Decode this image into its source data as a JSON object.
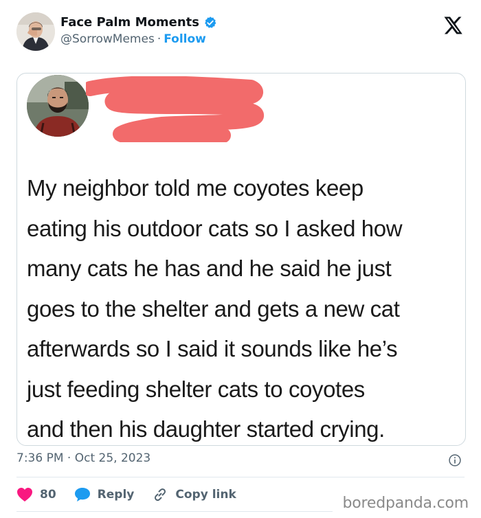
{
  "author": {
    "display_name": "Face Palm Moments",
    "handle": "@SorrowMemes",
    "separator": "·",
    "follow_label": "Follow"
  },
  "quoted_tweet": {
    "lines": [
      "My neighbor told me coyotes keep",
      "eating his outdoor cats so I asked how",
      "many cats he has and he said he just",
      "goes to the shelter and gets a new cat",
      "afterwards so I said it sounds like he’s",
      "just feeding shelter cats to coyotes",
      "and then his daughter started crying."
    ]
  },
  "meta": {
    "time": "7:36 PM",
    "separator": "·",
    "date": "Oct 25, 2023"
  },
  "actions": {
    "like_count": "80",
    "reply_label": "Reply",
    "copy_label": "Copy link"
  },
  "watermark": "boredpanda.com",
  "colors": {
    "accent": "#1d9bf0",
    "like": "#f91880",
    "text": "#0f1419",
    "muted": "#536471",
    "redaction": "#f26b6b"
  },
  "icons": {
    "verified": "verified-badge-icon",
    "platform": "x-logo-icon",
    "info": "info-icon",
    "like": "heart-icon",
    "reply": "speech-bubble-icon",
    "copy": "link-icon"
  }
}
